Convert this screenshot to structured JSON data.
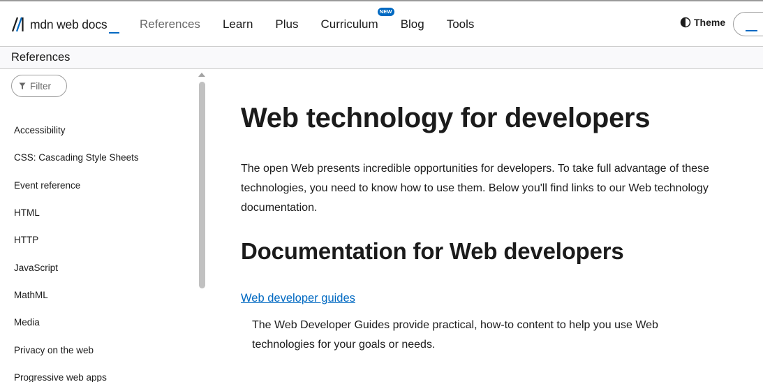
{
  "header": {
    "logo_text": "mdn web docs",
    "nav": [
      {
        "label": "References",
        "active": true
      },
      {
        "label": "Learn"
      },
      {
        "label": "Plus"
      },
      {
        "label": "Curriculum",
        "badge": "NEW"
      },
      {
        "label": "Blog"
      },
      {
        "label": "Tools"
      }
    ],
    "theme_label": "Theme"
  },
  "breadcrumb": {
    "label": "References"
  },
  "sidebar": {
    "filter_label": "Filter",
    "items": [
      "Accessibility",
      "CSS: Cascading Style Sheets",
      "Event reference",
      "HTML",
      "HTTP",
      "JavaScript",
      "MathML",
      "Media",
      "Privacy on the web",
      "Progressive web apps"
    ]
  },
  "main": {
    "title": "Web technology for developers",
    "intro": "The open Web presents incredible opportunities for developers. To take full advantage of these technologies, you need to know how to use them. Below you'll find links to our Web technology documentation.",
    "section_title": "Documentation for Web developers",
    "guide_link": "Web developer guides",
    "guide_desc": "The Web Developer Guides provide practical, how-to content to help you use Web technologies for your goals or needs."
  },
  "colors": {
    "accent": "#0069c2",
    "text": "#1b1b1b",
    "muted": "#696969",
    "border": "#cdcdcd"
  },
  "icons": [
    "mdn-logo-icon",
    "contrast-icon",
    "filter-icon",
    "scroll-up-arrow-icon"
  ]
}
